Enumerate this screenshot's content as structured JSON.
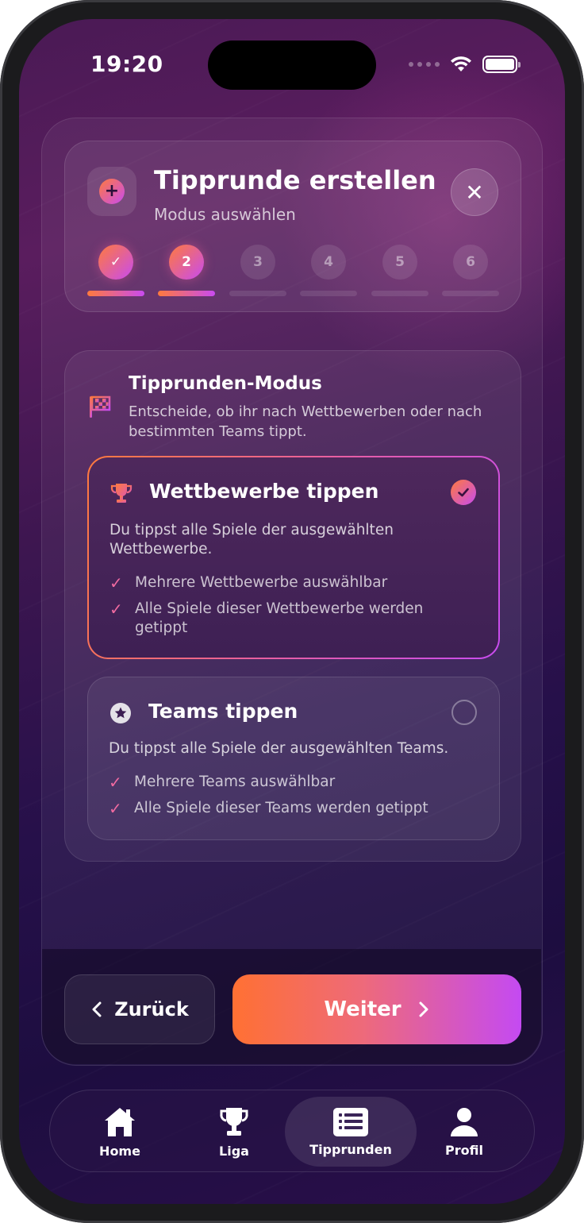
{
  "status": {
    "time": "19:20"
  },
  "header": {
    "title": "Tipprunde erstellen",
    "subtitle": "Modus auswählen"
  },
  "steps": [
    {
      "label": "✓",
      "state": "done"
    },
    {
      "label": "2",
      "state": "active"
    },
    {
      "label": "3",
      "state": "pending"
    },
    {
      "label": "4",
      "state": "pending"
    },
    {
      "label": "5",
      "state": "pending"
    },
    {
      "label": "6",
      "state": "pending"
    }
  ],
  "mode": {
    "title": "Tipprunden-Modus",
    "description": "Entscheide, ob ihr nach Wettbewerben oder nach bestimmten Teams tippt."
  },
  "options": [
    {
      "title": "Wettbewerbe tippen",
      "description": "Du tippst alle Spiele der ausgewählten Wettbewerbe.",
      "features": [
        "Mehrere Wettbewerbe auswählbar",
        "Alle Spiele dieser Wettbewerbe werden getippt"
      ],
      "selected": true,
      "icon": "trophy-icon"
    },
    {
      "title": "Teams tippen",
      "description": "Du tippst alle Spiele der ausgewählten Teams.",
      "features": [
        "Mehrere Teams auswählbar",
        "Alle Spiele dieser Teams werden getippt"
      ],
      "selected": false,
      "icon": "star-icon"
    }
  ],
  "buttons": {
    "back": "Zurück",
    "next": "Weiter"
  },
  "tabs": [
    {
      "label": "Home",
      "icon": "home-icon"
    },
    {
      "label": "Liga",
      "icon": "trophy-icon"
    },
    {
      "label": "Tipprunden",
      "icon": "list-icon",
      "active": true
    },
    {
      "label": "Profil",
      "icon": "person-icon"
    }
  ],
  "colors": {
    "accent_start": "#ff7a3d",
    "accent_end": "#c84bf0",
    "check": "#f06aa0"
  }
}
